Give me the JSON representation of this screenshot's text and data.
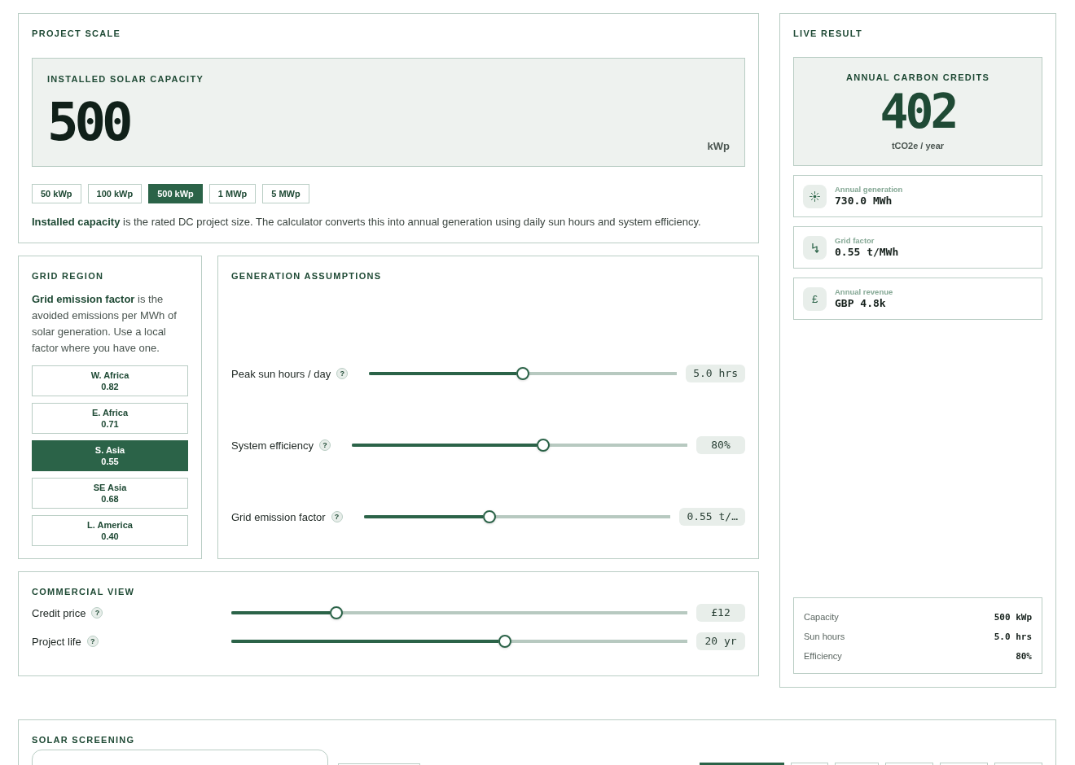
{
  "project_scale": {
    "title": "PROJECT SCALE",
    "capacity": {
      "label": "INSTALLED SOLAR CAPACITY",
      "value": "500",
      "unit": "kWp"
    },
    "presets": [
      {
        "label": "50 kWp",
        "selected": false
      },
      {
        "label": "100 kWp",
        "selected": false
      },
      {
        "label": "500 kWp",
        "selected": true
      },
      {
        "label": "1 MWp",
        "selected": false
      },
      {
        "label": "5 MWp",
        "selected": false
      }
    ],
    "note": "**Installed capacity** is the rated DC project size. The calculator converts this into annual generation using daily sun hours and system efficiency."
  },
  "grid_region": {
    "title": "GRID REGION",
    "note": "**Grid emission factor** is the avoided emissions per MWh of solar generation. Use a local factor where you have one.",
    "regions": [
      {
        "name": "W. Africa",
        "factor": "0.82",
        "selected": false
      },
      {
        "name": "E. Africa",
        "factor": "0.71",
        "selected": false
      },
      {
        "name": "S. Asia",
        "factor": "0.55",
        "selected": true
      },
      {
        "name": "SE Asia",
        "factor": "0.68",
        "selected": false
      },
      {
        "name": "L. America",
        "factor": "0.40",
        "selected": false
      }
    ]
  },
  "generation": {
    "title": "GENERATION ASSUMPTIONS",
    "sliders": [
      {
        "label": "Peak sun hours / day",
        "help": "?",
        "level": 0.5,
        "reading": "5.0 hrs"
      },
      {
        "label": "System efficiency",
        "help": "?",
        "level": 0.57,
        "reading": "80%"
      },
      {
        "label": "Grid emission factor",
        "help": "?",
        "level": 0.41,
        "reading": "0.55 t/…"
      }
    ]
  },
  "commercial": {
    "title": "COMMERCIAL VIEW",
    "sliders": [
      {
        "label": "Credit price",
        "help": "?",
        "level": 0.23,
        "reading": "£12"
      },
      {
        "label": "Project life",
        "help": "?",
        "level": 0.6,
        "reading": "20 yr"
      }
    ]
  },
  "live_result": {
    "title": "LIVE RESULT",
    "headline": {
      "label": "ANNUAL CARBON CREDITS",
      "value": "402",
      "unit": "tCO2e / year"
    },
    "metrics": [
      {
        "kind": "sun",
        "label": "Annual generation",
        "value": "730.0 MWh"
      },
      {
        "kind": "bolt",
        "label": "Grid factor",
        "value": "0.55 t/MWh"
      },
      {
        "kind": "currency",
        "icon": "£",
        "label": "Annual revenue",
        "value": "GBP 4.8k"
      }
    ],
    "summary": [
      {
        "label": "Capacity",
        "value": "500 kWp"
      },
      {
        "label": "Sun hours",
        "value": "5.0 hrs"
      },
      {
        "label": "Efficiency",
        "value": "80%"
      }
    ]
  },
  "solar_screening": {
    "title": "SOLAR SCREENING",
    "fields": [
      {
        "kind": "textarea"
      },
      {
        "kind": "input"
      }
    ],
    "options": [
      {
        "selected": true
      },
      {
        "selected": false
      },
      {
        "selected": false
      },
      {
        "selected": false
      },
      {
        "selected": false
      },
      {
        "selected": false
      }
    ]
  }
}
